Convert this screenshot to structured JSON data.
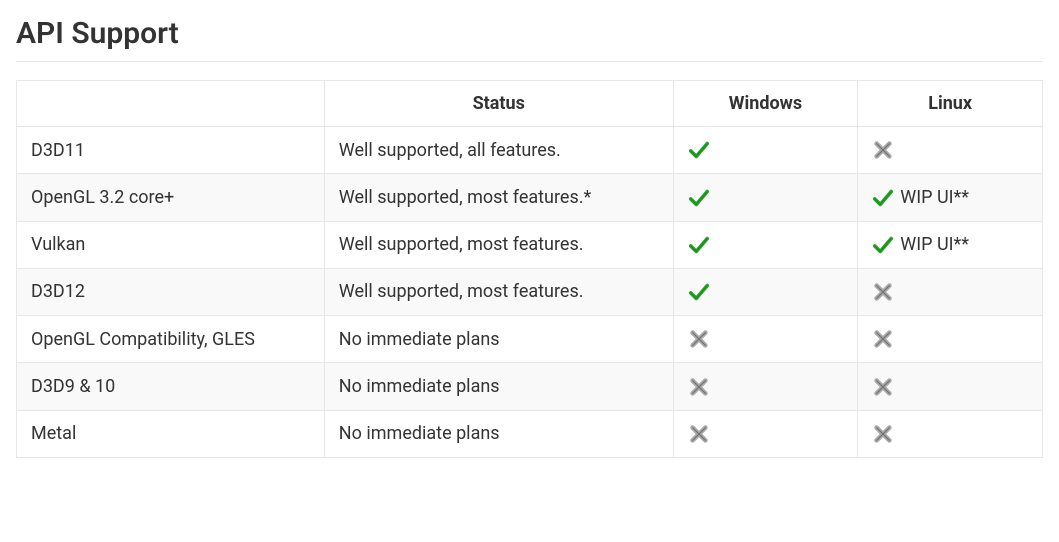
{
  "heading": "API Support",
  "columns": [
    "",
    "Status",
    "Windows",
    "Linux"
  ],
  "rows": [
    {
      "api": "D3D11",
      "status": "Well supported, all features.",
      "windows": {
        "support": "yes"
      },
      "linux": {
        "support": "no"
      }
    },
    {
      "api": "OpenGL 3.2 core+",
      "status": "Well supported, most features.*",
      "windows": {
        "support": "yes"
      },
      "linux": {
        "support": "yes",
        "note": "WIP UI**"
      }
    },
    {
      "api": "Vulkan",
      "status": "Well supported, most features.",
      "windows": {
        "support": "yes"
      },
      "linux": {
        "support": "yes",
        "note": "WIP UI**"
      }
    },
    {
      "api": "D3D12",
      "status": "Well supported, most features.",
      "windows": {
        "support": "yes"
      },
      "linux": {
        "support": "no"
      }
    },
    {
      "api": "OpenGL Compatibility, GLES",
      "status": "No immediate plans",
      "windows": {
        "support": "no"
      },
      "linux": {
        "support": "no"
      }
    },
    {
      "api": "D3D9 & 10",
      "status": "No immediate plans",
      "windows": {
        "support": "no"
      },
      "linux": {
        "support": "no"
      }
    },
    {
      "api": "Metal",
      "status": "No immediate plans",
      "windows": {
        "support": "no"
      },
      "linux": {
        "support": "no"
      }
    }
  ],
  "icons": {
    "yes": "check-icon",
    "no": "cross-icon"
  }
}
